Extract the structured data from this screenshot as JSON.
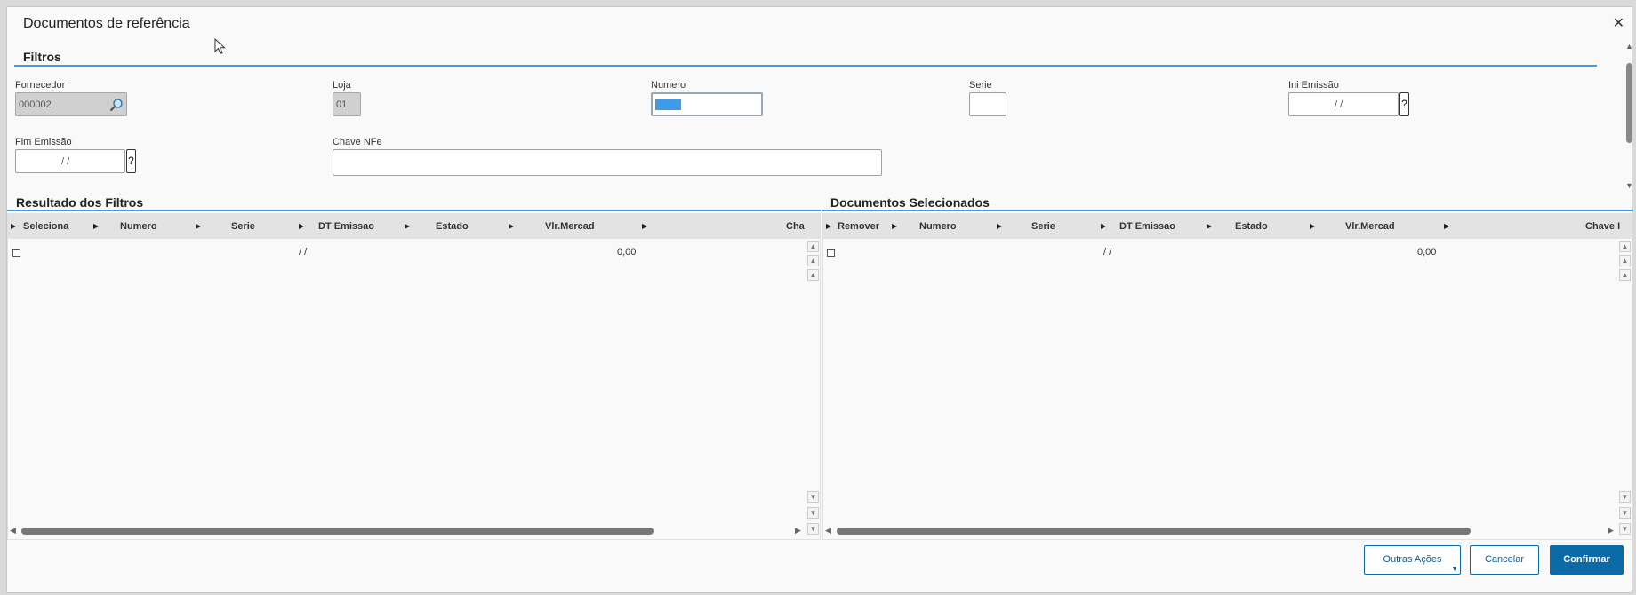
{
  "dialog": {
    "title": "Documentos de referência",
    "close_glyph": "✕"
  },
  "filters": {
    "heading": "Filtros",
    "fornecedor": {
      "label": "Fornecedor",
      "value": "000002"
    },
    "loja": {
      "label": "Loja",
      "value": "01"
    },
    "numero": {
      "label": "Numero",
      "value": ""
    },
    "serie": {
      "label": "Serie",
      "value": ""
    },
    "ini_emissao": {
      "label": "Ini Emissão",
      "value": "/ /"
    },
    "fim_emissao": {
      "label": "Fim Emissão",
      "value": "/ /"
    },
    "chave_nfe": {
      "label": "Chave NFe",
      "value": ""
    },
    "help_glyph": "?"
  },
  "results": {
    "heading": "Resultado dos Filtros",
    "columns": [
      "Seleciona",
      "Numero",
      "Serie",
      "DT Emissao",
      "Estado",
      "Vlr.Mercad",
      "Cha"
    ],
    "rows": [
      {
        "dt_emissao": "/ /",
        "vlr_mercad": "0,00"
      }
    ]
  },
  "selected": {
    "heading": "Documentos Selecionados",
    "columns": [
      "Remover",
      "Numero",
      "Serie",
      "DT Emissao",
      "Estado",
      "Vlr.Mercad",
      "Chave I"
    ],
    "rows": [
      {
        "dt_emissao": "/ /",
        "vlr_mercad": "0,00"
      }
    ]
  },
  "footer": {
    "outras_acoes": "Outras Ações",
    "cancelar": "Cancelar",
    "confirmar": "Confirmar"
  },
  "colors": {
    "accent": "#3d9be9",
    "primary_button": "#0c6aa7"
  },
  "icons": [
    "search-icon",
    "close-icon",
    "help-icon",
    "caret-down-icon",
    "mouse-cursor-icon"
  ]
}
